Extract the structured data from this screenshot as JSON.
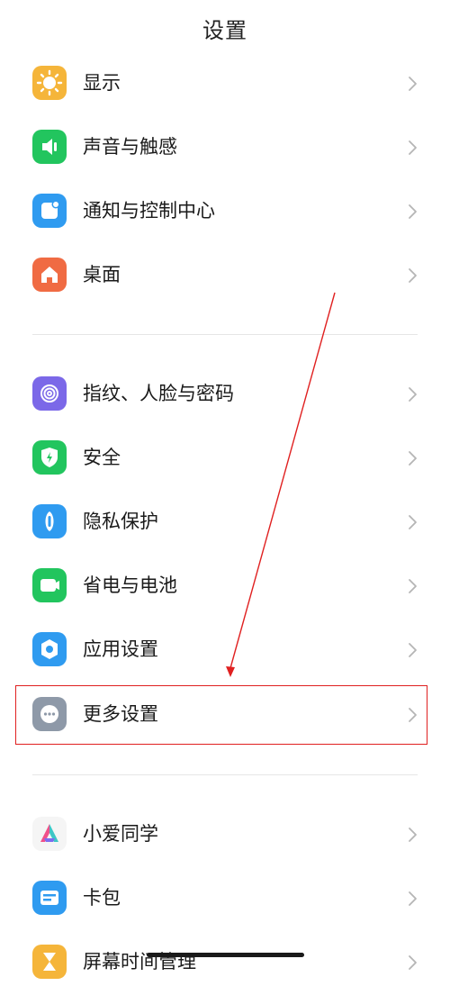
{
  "header": {
    "title": "设置"
  },
  "groups": [
    [
      {
        "label": "显示",
        "icon": "sun-icon",
        "color": "#F5B53A"
      },
      {
        "label": "声音与触感",
        "icon": "speaker-icon",
        "color": "#22C55E"
      },
      {
        "label": "通知与控制中心",
        "icon": "notification-icon",
        "color": "#2F9BF0"
      },
      {
        "label": "桌面",
        "icon": "home-icon",
        "color": "#F06B43"
      }
    ],
    [
      {
        "label": "指纹、人脸与密码",
        "icon": "fingerprint-icon",
        "color": "#7B68E8"
      },
      {
        "label": "安全",
        "icon": "shield-icon",
        "color": "#22C55E"
      },
      {
        "label": "隐私保护",
        "icon": "privacy-icon",
        "color": "#2F9BF0"
      },
      {
        "label": "省电与电池",
        "icon": "battery-icon",
        "color": "#22C55E"
      },
      {
        "label": "应用设置",
        "icon": "gear-icon",
        "color": "#2F9BF0"
      },
      {
        "label": "更多设置",
        "icon": "more-icon",
        "color": "#8E99A8"
      }
    ],
    [
      {
        "label": "小爱同学",
        "icon": "xiaoai-icon",
        "color": "#F5F5F5"
      },
      {
        "label": "卡包",
        "icon": "wallet-icon",
        "color": "#2F9BF0"
      },
      {
        "label": "屏幕时间管理",
        "icon": "hourglass-icon",
        "color": "#F5B53A"
      }
    ]
  ],
  "annotation": {
    "highlight_color": "#E02020",
    "highlighted_item": "更多设置"
  }
}
